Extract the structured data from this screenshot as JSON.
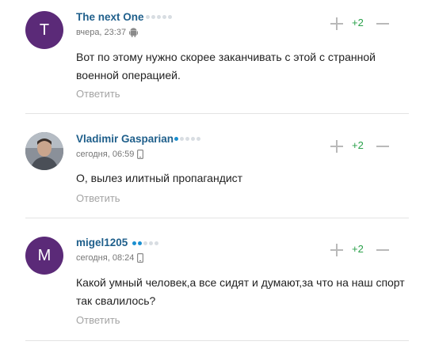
{
  "comments": [
    {
      "avatar_letter": "T",
      "avatar_color": "#5b2a78",
      "author": "The next One",
      "rating_dots": {
        "active": 0,
        "total": 5
      },
      "time": "вчера, 23:37",
      "device": "android-icon",
      "text": "Вот по этому нужно скорее заканчивать с этой с странной военной операцией.",
      "reply_label": "Ответить",
      "score": "+2"
    },
    {
      "avatar_letter": "",
      "avatar_color": "#5d6670",
      "author": "Vladimir Gasparian",
      "rating_dots": {
        "active": 1,
        "total": 5
      },
      "time": "сегодня, 06:59",
      "device": "phone-icon",
      "text": "О, вылез илитный пропагандист",
      "reply_label": "Ответить",
      "score": "+2"
    },
    {
      "avatar_letter": "M",
      "avatar_color": "#5b2a78",
      "author": "migel1205",
      "rating_dots": {
        "active": 2,
        "total": 5
      },
      "time": "сегодня, 08:24",
      "device": "phone-icon",
      "text": "Какой умный человек,а все сидят и думают,за что на наш спорт так свалилось?",
      "reply_label": "Ответить",
      "score": "+2"
    }
  ]
}
